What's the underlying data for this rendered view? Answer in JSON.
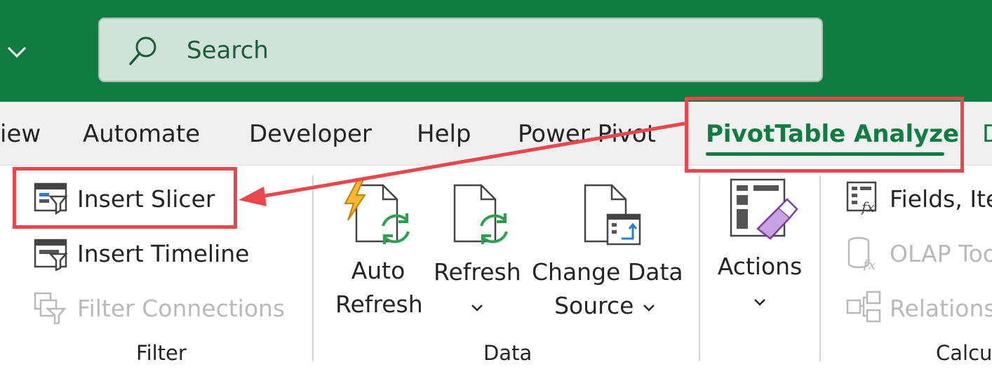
{
  "search": {
    "placeholder": "Search"
  },
  "tabs": [
    {
      "label": "iew"
    },
    {
      "label": "Automate"
    },
    {
      "label": "Developer"
    },
    {
      "label": "Help"
    },
    {
      "label": "Power Pivot"
    },
    {
      "label": "PivotTable Analyze",
      "active": true
    },
    {
      "label": "D"
    }
  ],
  "filter_group": {
    "insert_slicer": "Insert Slicer",
    "insert_timeline": "Insert Timeline",
    "filter_connections": "Filter Connections",
    "label": "Filter"
  },
  "data_group": {
    "auto_refresh_line1": "Auto",
    "auto_refresh_line2": "Refresh",
    "refresh": "Refresh",
    "change_data_source_line1": "Change Data",
    "change_data_source_line2": "Source",
    "label": "Data"
  },
  "actions_group": {
    "actions": "Actions"
  },
  "calc_group": {
    "fields_items": "Fields, Ite",
    "olap_tools": "OLAP Too",
    "relationships": "Relations",
    "label": "Calcu"
  },
  "colors": {
    "titlebar": "#107c41",
    "active_tab": "#107c41",
    "highlight": "#e8474d"
  }
}
